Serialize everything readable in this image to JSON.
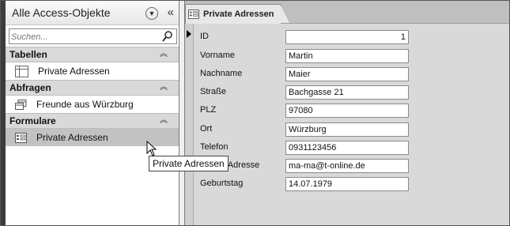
{
  "nav": {
    "header_title": "Alle Access-Objekte",
    "search_placeholder": "Suchen...",
    "groups": [
      {
        "label": "Tabellen",
        "items": [
          {
            "label": "Private Adressen"
          }
        ]
      },
      {
        "label": "Abfragen",
        "items": [
          {
            "label": "Freunde aus Würzburg"
          }
        ]
      },
      {
        "label": "Formulare",
        "items": [
          {
            "label": "Private Adressen"
          }
        ]
      }
    ],
    "tooltip": "Private Adressen"
  },
  "document": {
    "tab_label": "Private Adressen"
  },
  "form": {
    "fields": [
      {
        "label": "ID",
        "value": "1"
      },
      {
        "label": "Vorname",
        "value": "Martin"
      },
      {
        "label": "Nachname",
        "value": "Maier"
      },
      {
        "label": "Straße",
        "value": "Bachgasse 21"
      },
      {
        "label": "PLZ",
        "value": "97080"
      },
      {
        "label": "Ort",
        "value": "Würzburg"
      },
      {
        "label": "Telefon",
        "value": "0931123456"
      },
      {
        "label": "E-Mail-Adresse",
        "value": "ma-ma@t-online.de"
      },
      {
        "label": "Geburtstag",
        "value": "14.07.1979"
      }
    ]
  }
}
